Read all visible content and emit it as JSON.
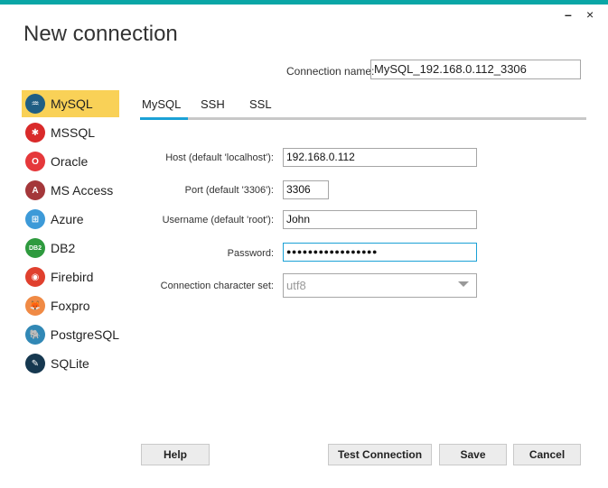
{
  "window": {
    "title": "New connection",
    "minimize_label": "–",
    "close_label": "×",
    "accent_color": "#0aa6a6"
  },
  "connection_name": {
    "label": "Connection name:",
    "value": "MySQL_192.168.0.112_3306"
  },
  "sidebar": {
    "items": [
      {
        "label": "MySQL",
        "icon": "mysql-dolphin-icon",
        "color": "#1f5e84",
        "glyph": "♒",
        "active": true
      },
      {
        "label": "MSSQL",
        "icon": "mssql-icon",
        "color": "#d92a2a",
        "glyph": "✱",
        "active": false
      },
      {
        "label": "Oracle",
        "icon": "oracle-icon",
        "color": "#e5383b",
        "glyph": "O",
        "active": false
      },
      {
        "label": "MS Access",
        "icon": "ms-access-icon",
        "color": "#a4373a",
        "glyph": "A",
        "active": false
      },
      {
        "label": "Azure",
        "icon": "azure-windows-icon",
        "color": "#3d9ad8",
        "glyph": "⊞",
        "active": false
      },
      {
        "label": "DB2",
        "icon": "db2-ibm-icon",
        "color": "#2e9a3e",
        "glyph": "DB2",
        "active": false
      },
      {
        "label": "Firebird",
        "icon": "firebird-icon",
        "color": "#e0402e",
        "glyph": "◉",
        "active": false
      },
      {
        "label": "Foxpro",
        "icon": "foxpro-icon",
        "color": "#f08a45",
        "glyph": "🦊",
        "active": false
      },
      {
        "label": "PostgreSQL",
        "icon": "postgresql-elephant-icon",
        "color": "#3188b5",
        "glyph": "🐘",
        "active": false
      },
      {
        "label": "SQLite",
        "icon": "sqlite-feather-icon",
        "color": "#163850",
        "glyph": "✎",
        "active": false
      }
    ]
  },
  "tabs": [
    {
      "label": "MySQL",
      "active": true
    },
    {
      "label": "SSH",
      "active": false
    },
    {
      "label": "SSL",
      "active": false
    }
  ],
  "form": {
    "host": {
      "label": "Host (default 'localhost'):",
      "value": "192.168.0.112"
    },
    "port": {
      "label": "Port (default '3306'):",
      "value": "3306"
    },
    "username": {
      "label": "Username (default 'root'):",
      "value": "John"
    },
    "password": {
      "label": "Password:",
      "value": "●●●●●●●●●●●●●●●●●"
    },
    "charset": {
      "label": "Connection character set:",
      "value": "utf8"
    }
  },
  "buttons": {
    "help": "Help",
    "test_connection": "Test Connection",
    "save": "Save",
    "cancel": "Cancel"
  }
}
